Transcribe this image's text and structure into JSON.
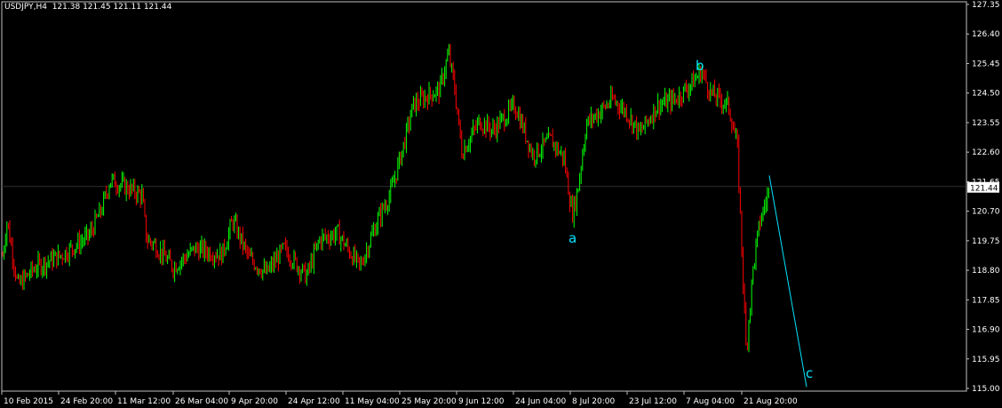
{
  "header": {
    "symbol": "USDJPY,H4",
    "open": "121.38",
    "high": "121.45",
    "low": "121.11",
    "close": "121.44"
  },
  "price_scale": [
    "127.35",
    "126.40",
    "125.45",
    "124.50",
    "123.55",
    "122.60",
    "121.65",
    "120.70",
    "119.75",
    "118.80",
    "117.85",
    "116.90",
    "115.95",
    "115.00"
  ],
  "current_price": "121.44",
  "time_scale": [
    "10 Feb 2015",
    "24 Feb 20:00",
    "11 Mar 12:00",
    "26 Mar 04:00",
    "9 Apr 20:00",
    "24 Apr 12:00",
    "11 May 04:00",
    "25 May 20:00",
    "9 Jun 12:00",
    "24 Jun 04:00",
    "8 Jul 20:00",
    "23 Jul 12:00",
    "7 Aug 04:00",
    "21 Aug 20:00"
  ],
  "wave_labels": {
    "a": "a",
    "b": "b",
    "c": "c"
  },
  "colors": {
    "background": "#000000",
    "bull": "#00ff00",
    "bear": "#ff0000",
    "axis": "#c0c0c0",
    "wave_line": "#00e5ff",
    "label_text": "#ffffff"
  },
  "chart_data": {
    "type": "line",
    "title": "USDJPY,H4",
    "ylim": [
      115.0,
      127.35
    ],
    "x": [
      "10 Feb 2015",
      "24 Feb 20:00",
      "11 Mar 12:00",
      "26 Mar 04:00",
      "9 Apr 20:00",
      "24 Apr 12:00",
      "11 May 04:00",
      "25 May 20:00",
      "9 Jun 12:00",
      "24 Jun 04:00",
      "8 Jul 20:00",
      "23 Jul 12:00",
      "7 Aug 04:00",
      "21 Aug 20:00"
    ],
    "series": [
      {
        "values": [
          118.6,
          119.0,
          121.4,
          119.0,
          120.2,
          119.5,
          119.4,
          124.2,
          123.5,
          123.1,
          123.8,
          124.0,
          124.5,
          121.4
        ]
      }
    ],
    "price_path": [
      [
        0,
        118.6
      ],
      [
        8,
        120.4
      ],
      [
        20,
        118.3
      ],
      [
        40,
        118.9
      ],
      [
        70,
        119.3
      ],
      [
        100,
        119.9
      ],
      [
        115,
        120.8
      ],
      [
        124,
        121.7
      ],
      [
        140,
        121.5
      ],
      [
        160,
        121.2
      ],
      [
        165,
        119.8
      ],
      [
        175,
        119.6
      ],
      [
        195,
        118.9
      ],
      [
        220,
        119.5
      ],
      [
        250,
        119.3
      ],
      [
        262,
        120.4
      ],
      [
        280,
        119.2
      ],
      [
        300,
        118.7
      ],
      [
        320,
        119.5
      ],
      [
        345,
        118.6
      ],
      [
        360,
        119.8
      ],
      [
        380,
        120.0
      ],
      [
        405,
        118.9
      ],
      [
        425,
        120.4
      ],
      [
        440,
        121.3
      ],
      [
        455,
        122.9
      ],
      [
        465,
        124.1
      ],
      [
        480,
        124.4
      ],
      [
        495,
        124.6
      ],
      [
        505,
        125.8
      ],
      [
        512,
        124.6
      ],
      [
        520,
        122.6
      ],
      [
        540,
        123.6
      ],
      [
        555,
        123.3
      ],
      [
        580,
        124.1
      ],
      [
        600,
        122.5
      ],
      [
        620,
        123.0
      ],
      [
        635,
        122.4
      ],
      [
        644,
        120.6
      ],
      [
        650,
        121.3
      ],
      [
        660,
        123.5
      ],
      [
        690,
        124.3
      ],
      [
        705,
        123.9
      ],
      [
        720,
        123.2
      ],
      [
        740,
        124.1
      ],
      [
        760,
        124.3
      ],
      [
        775,
        124.7
      ],
      [
        790,
        125.2
      ],
      [
        800,
        124.5
      ],
      [
        820,
        124.1
      ],
      [
        830,
        122.8
      ],
      [
        840,
        116.2
      ],
      [
        848,
        118.9
      ],
      [
        855,
        120.3
      ],
      [
        865,
        121.3
      ]
    ],
    "wave_c_target": [
      908,
      115.05
    ],
    "wave_a_point": [
      645,
      120.45
    ],
    "wave_b_point": [
      789,
      125.3
    ]
  }
}
